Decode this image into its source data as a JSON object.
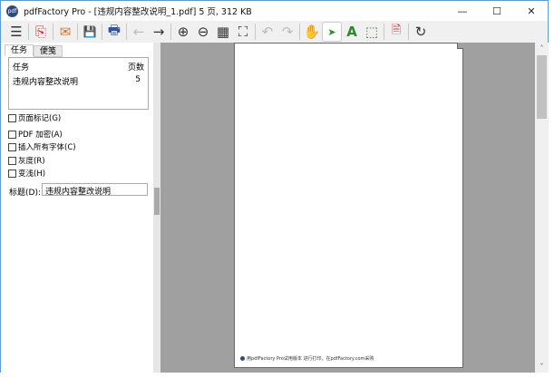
{
  "window": {
    "title": "pdfFactory Pro - [违规内容整改说明_1.pdf] 5 页, 312 KB",
    "app_icon": "pdf",
    "minimize": "—",
    "maximize": "☐",
    "close": "✕"
  },
  "toolbar": {
    "menu": "☰",
    "pdf": "⎘",
    "email": "✉",
    "save": "💾",
    "print": "🖶",
    "back": "←",
    "forward": "→",
    "zoom_in": "⊕",
    "zoom_out": "⊖",
    "grid": "▦",
    "fit": "⛶",
    "undo": "↶",
    "redo": "↷",
    "hand": "✋",
    "select": "➤",
    "text": "A",
    "marquee": "⬚",
    "delete": "🗎",
    "refresh": "↻"
  },
  "left": {
    "tabs": [
      "任务",
      "便笺"
    ],
    "list": {
      "headers": [
        "任务",
        "页数"
      ],
      "rows": [
        {
          "name": "违规内容整改说明",
          "pages": "5"
        }
      ]
    },
    "checkboxes": [
      "页面标记(G)",
      "PDF 加密(A)",
      "插入所有字体(C)",
      "灰度(R)",
      "变浅(H)"
    ],
    "title_label": "标题(D):",
    "title_value": "违规内容整改说明"
  },
  "preview": {
    "footer": "用pdfFactory Pro试用版本 进行打印，在pdfFactory.com采购"
  },
  "scrollbar": {
    "up": "˄",
    "down": "˅"
  }
}
